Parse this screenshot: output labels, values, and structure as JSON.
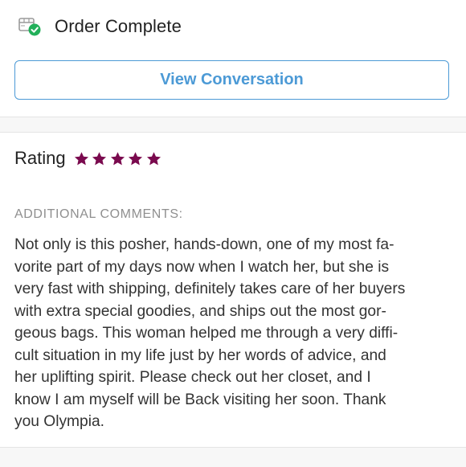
{
  "order": {
    "status": "Order Complete",
    "status_icon": "package-check-icon",
    "view_button_label": "View Conversation"
  },
  "rating": {
    "label": "Rating",
    "stars": 5,
    "max_stars": 5,
    "star_color": "#7a0a4e"
  },
  "comments": {
    "heading": "ADDITIONAL COMMENTS:",
    "lines": [
      "Not only is this posher, hands-down, one of my most fa-",
      "vorite part of my days now when I watch her, but she is",
      "very fast with shipping, definitely takes care of her buyers",
      "with extra special goodies, and ships out the most gor-",
      "geous bags. This woman helped me through a very diffi-",
      "cult situation in my life just by her words of advice, and",
      "her uplifting spirit. Please check out her closet, and I",
      "know I am myself will be Back visiting her soon. Thank",
      "you Olympia."
    ]
  },
  "colors": {
    "accent": "#4c9ad6",
    "check_green": "#22b05a"
  }
}
